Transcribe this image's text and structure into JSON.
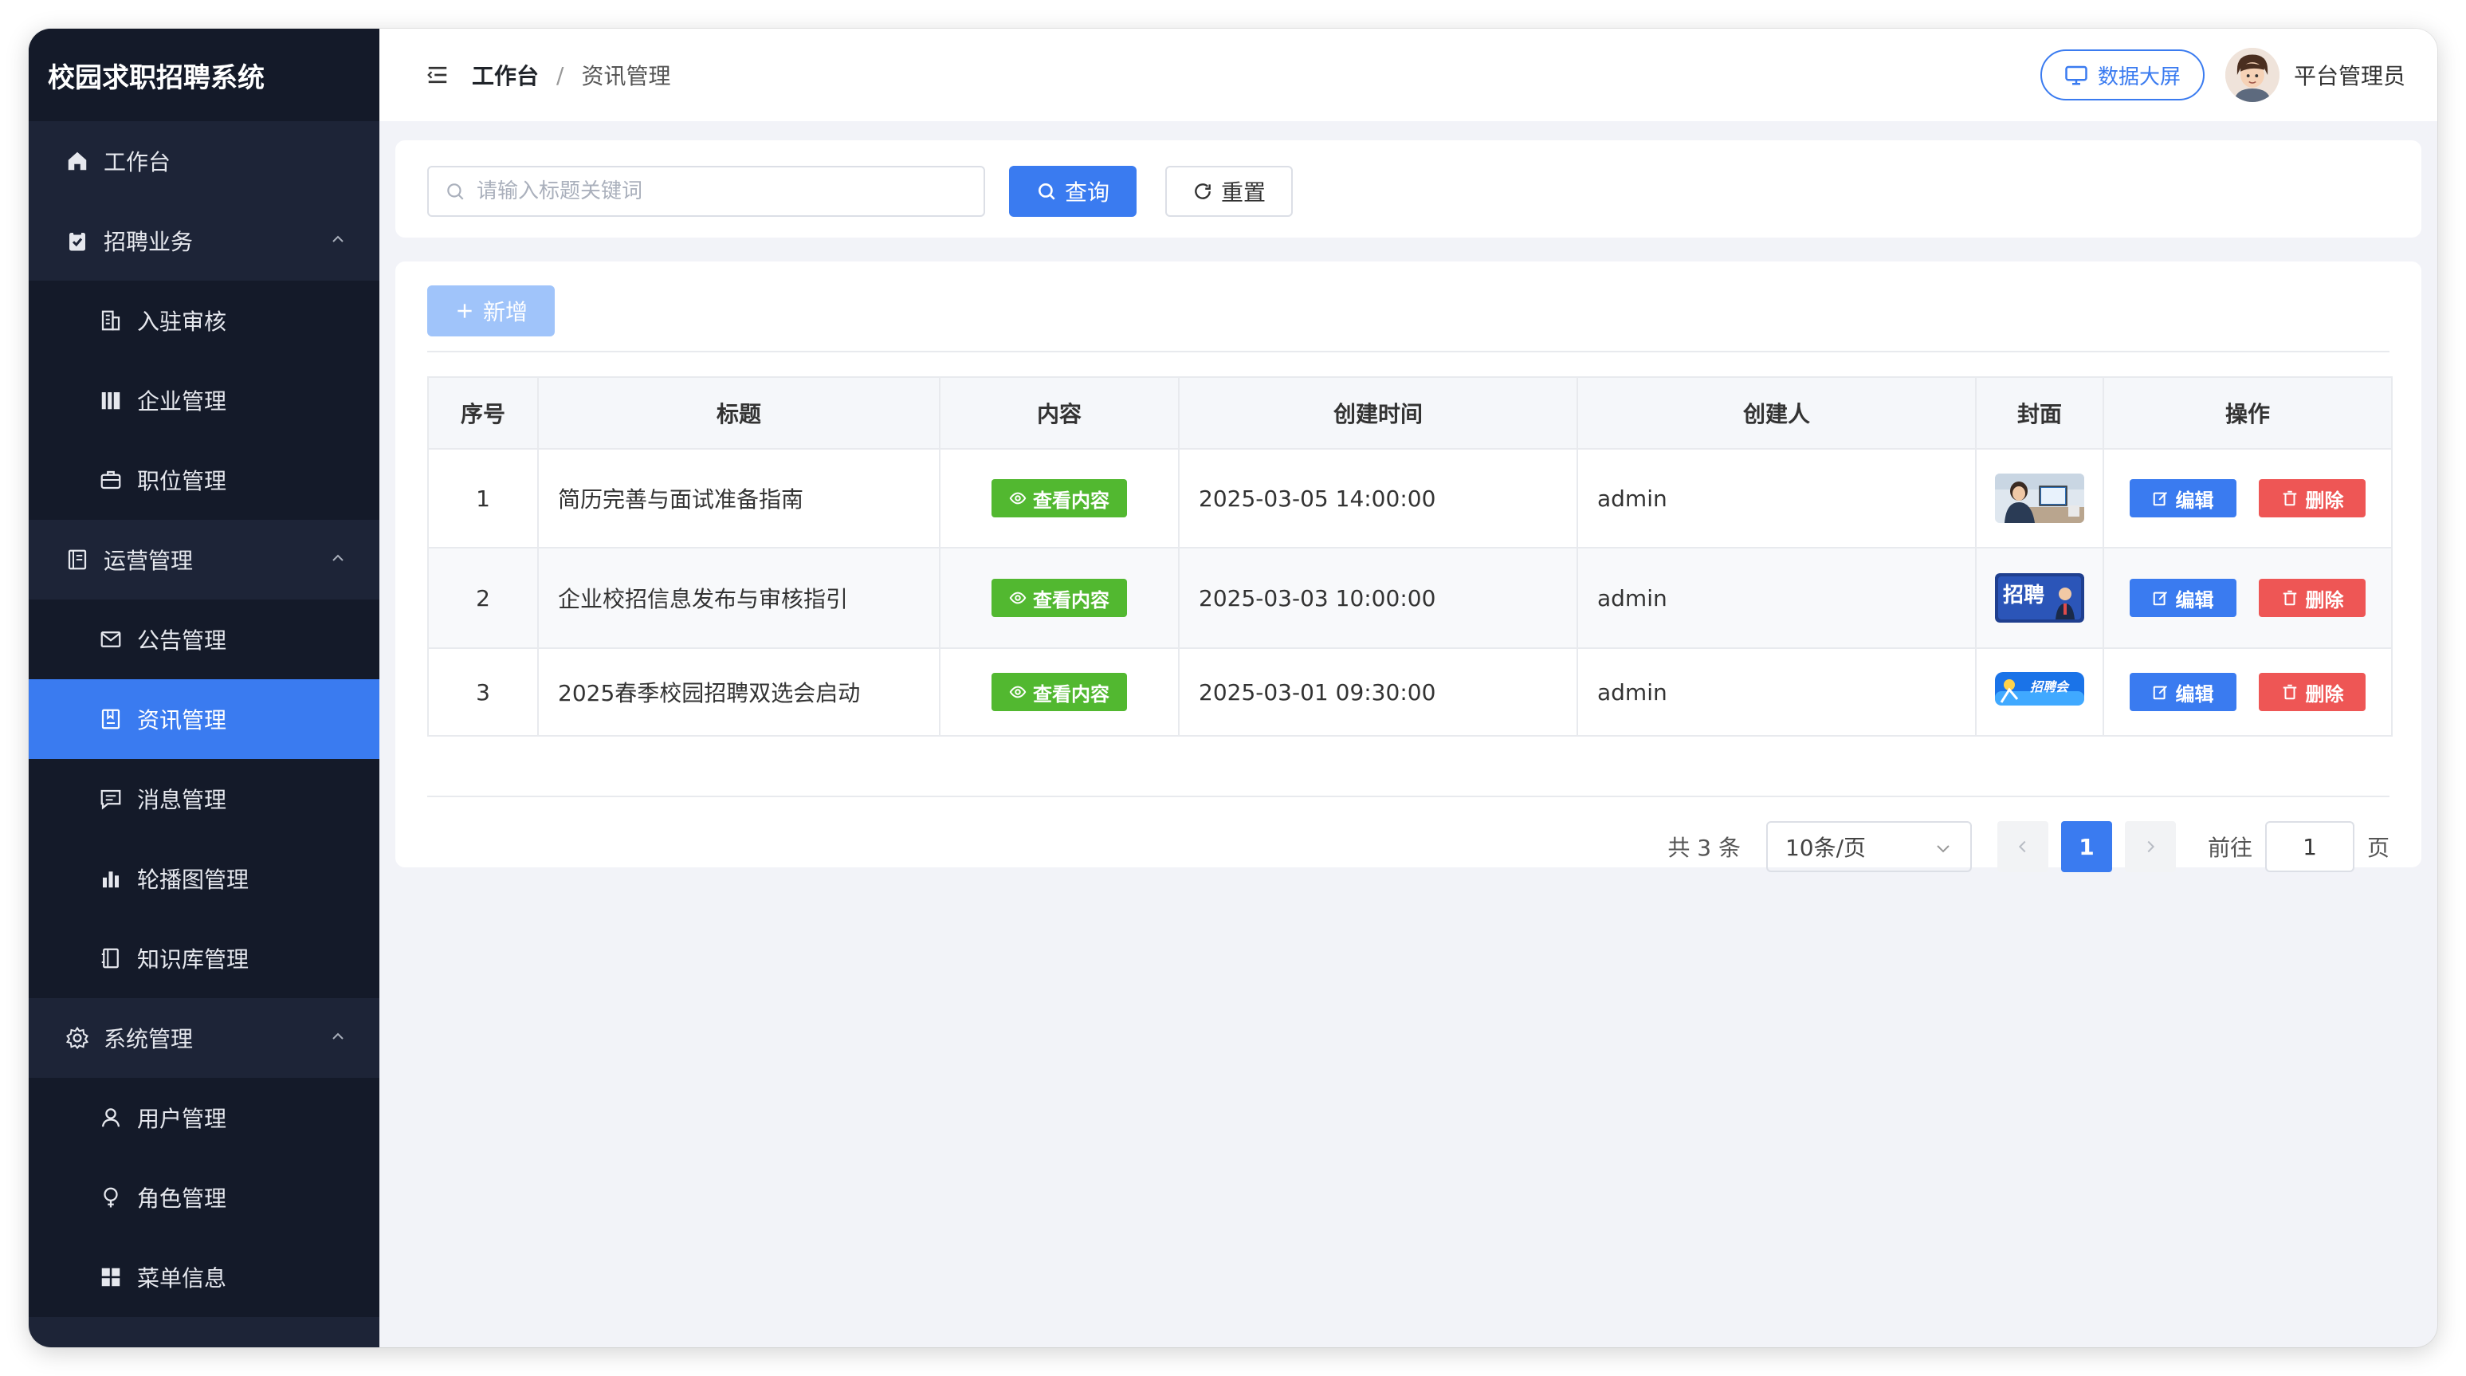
{
  "app": {
    "title": "校园求职招聘系统"
  },
  "sidebar": {
    "items": [
      {
        "label": "工作台",
        "icon": "home-icon",
        "level": "top"
      },
      {
        "label": "招聘业务",
        "icon": "clipboard-check-icon",
        "level": "top",
        "expanded": true
      },
      {
        "label": "入驻审核",
        "icon": "building-icon",
        "level": "sub"
      },
      {
        "label": "企业管理",
        "icon": "library-icon",
        "level": "sub"
      },
      {
        "label": "职位管理",
        "icon": "briefcase-icon",
        "level": "sub"
      },
      {
        "label": "运营管理",
        "icon": "document-icon",
        "level": "top",
        "expanded": true
      },
      {
        "label": "公告管理",
        "icon": "mail-icon",
        "level": "sub"
      },
      {
        "label": "资讯管理",
        "icon": "reading-icon",
        "level": "sub",
        "active": true
      },
      {
        "label": "消息管理",
        "icon": "chat-icon",
        "level": "sub"
      },
      {
        "label": "轮播图管理",
        "icon": "bar-chart-icon",
        "level": "sub"
      },
      {
        "label": "知识库管理",
        "icon": "notebook-icon",
        "level": "sub"
      },
      {
        "label": "系统管理",
        "icon": "gear-icon",
        "level": "top",
        "expanded": true
      },
      {
        "label": "用户管理",
        "icon": "user-icon",
        "level": "sub"
      },
      {
        "label": "角色管理",
        "icon": "female-icon",
        "level": "sub"
      },
      {
        "label": "菜单信息",
        "icon": "grid-icon",
        "level": "sub"
      }
    ]
  },
  "header": {
    "breadcrumb": [
      "工作台",
      "资讯管理"
    ],
    "bigscreen_label": "数据大屏",
    "user_name": "平台管理员"
  },
  "search": {
    "placeholder": "请输入标题关键词",
    "query_label": "查询",
    "reset_label": "重置"
  },
  "toolbar": {
    "add_label": "新增"
  },
  "table": {
    "columns": [
      "序号",
      "标题",
      "内容",
      "创建时间",
      "创建人",
      "封面",
      "操作"
    ],
    "view_label": "查看内容",
    "edit_label": "编辑",
    "delete_label": "删除",
    "rows": [
      {
        "no": "1",
        "title": "简历完善与面试准备指南",
        "created_at": "2025-03-05 14:00:00",
        "creator": "admin",
        "cover": "office-photo"
      },
      {
        "no": "2",
        "title": "企业校招信息发布与审核指引",
        "created_at": "2025-03-03 10:00:00",
        "creator": "admin",
        "cover": "recruit-banner",
        "cover_text": "招聘"
      },
      {
        "no": "3",
        "title": "2025春季校园招聘双选会启动",
        "created_at": "2025-03-01 09:30:00",
        "creator": "admin",
        "cover": "job-fair-banner",
        "cover_text": "招聘会"
      }
    ]
  },
  "pagination": {
    "total_text": "共 3 条",
    "page_size": "10条/页",
    "current_page": "1",
    "goto_label": "前往",
    "goto_value": "1",
    "page_suffix": "页"
  },
  "colors": {
    "sidebar_bg": "#1d2437",
    "submenu_bg": "#141a29",
    "accent": "#3a7bf0",
    "success": "#52b830",
    "danger": "#ee5655"
  }
}
